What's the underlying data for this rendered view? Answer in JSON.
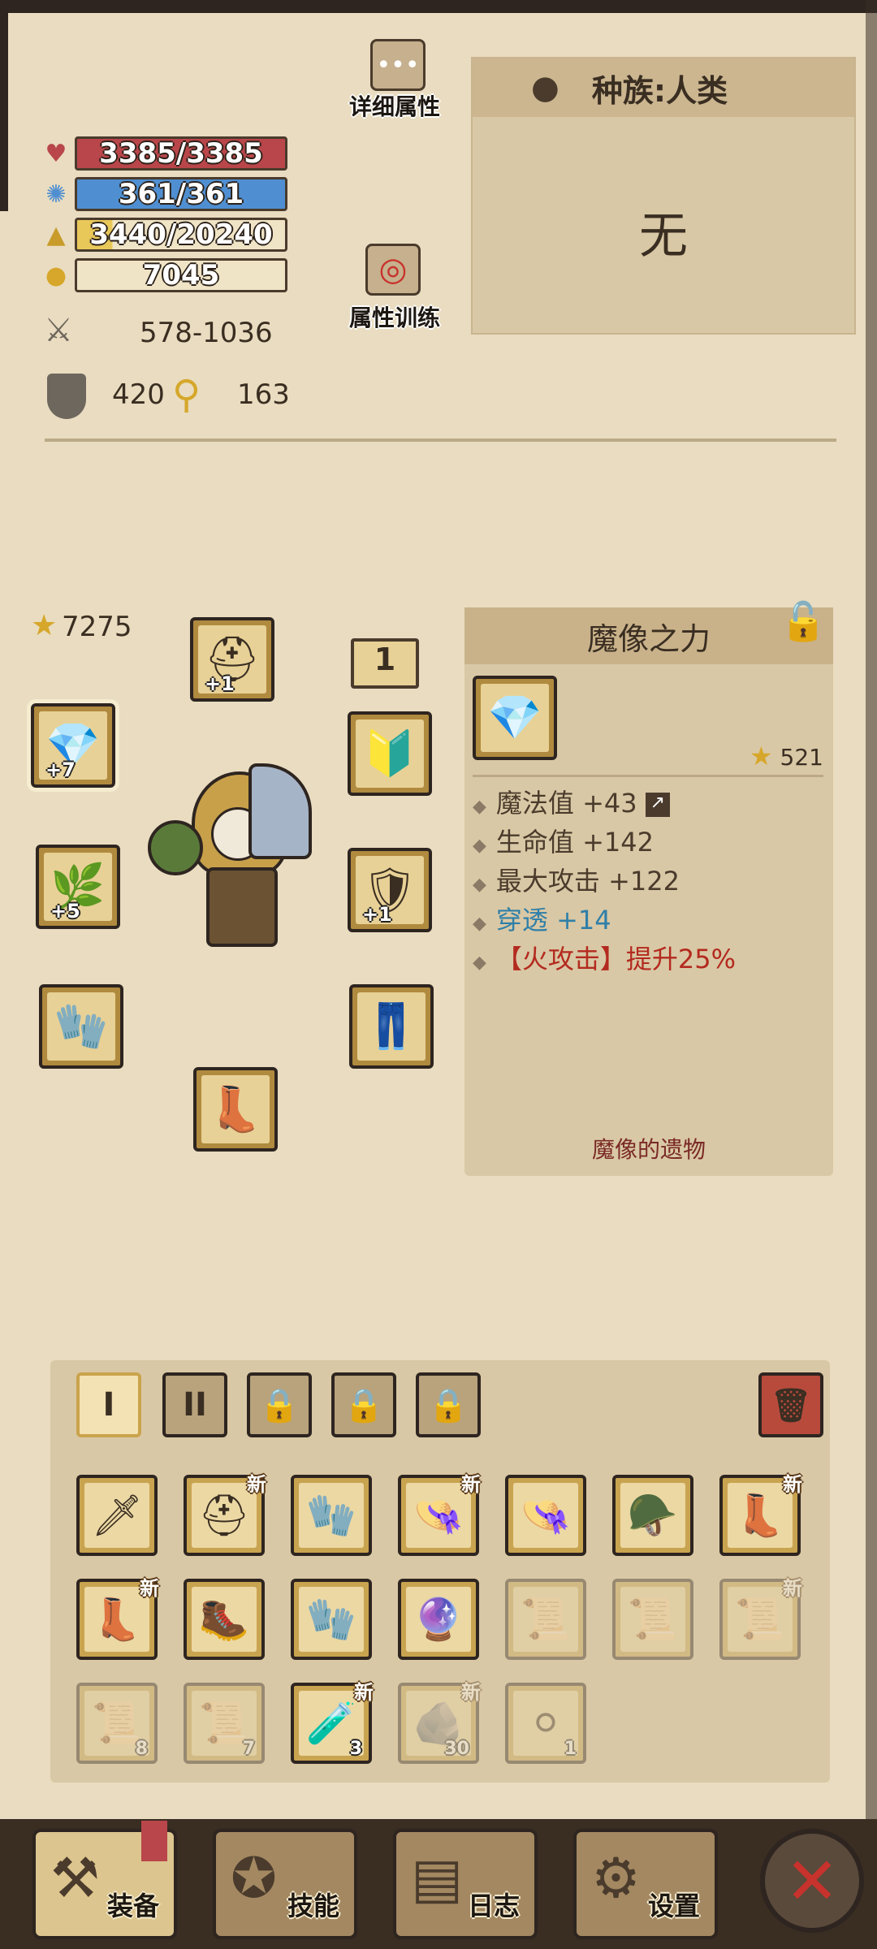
{
  "stats": {
    "hp": "3385/3385",
    "mp": "361/361",
    "exp": "3440/20240",
    "gold": "7045",
    "attack": "578-1036",
    "defense": "420",
    "pierce": "163"
  },
  "buttons": {
    "detail_attr": "详细属性",
    "attr_training": "属性训练"
  },
  "race": {
    "label": "种族:人类",
    "value": "无"
  },
  "equipment": {
    "score": "7275",
    "level_badge": "1",
    "slots": [
      {
        "name": "weapon-ring",
        "plus": "+7"
      },
      {
        "name": "helmet",
        "plus": "+1"
      },
      {
        "name": "amulet",
        "plus": ""
      },
      {
        "name": "staff",
        "plus": "+5"
      },
      {
        "name": "armor",
        "plus": "+1"
      },
      {
        "name": "gauntlet",
        "plus": ""
      },
      {
        "name": "pants",
        "plus": ""
      },
      {
        "name": "boots",
        "plus": ""
      }
    ]
  },
  "item_detail": {
    "title": "魔像之力",
    "score": "521",
    "lines": [
      "魔法值 +43",
      "生命值 +142",
      "最大攻击 +122",
      "穿透 +14",
      "【火攻击】提升25%"
    ],
    "flavor": "魔像的遗物"
  },
  "inventory": {
    "tabs": [
      "I",
      "II"
    ],
    "new_label": "新",
    "counts": [
      "8",
      "7",
      "3",
      "30",
      "1"
    ]
  },
  "nav": {
    "equip": "装备",
    "skills": "技能",
    "log": "日志",
    "settings": "设置"
  },
  "colors": {
    "hp": "#b8464a",
    "mp": "#4f8fd1",
    "exp": "#e9c85a",
    "pierce_text": "#2f7fa8",
    "fire_text": "#b32a1f"
  }
}
